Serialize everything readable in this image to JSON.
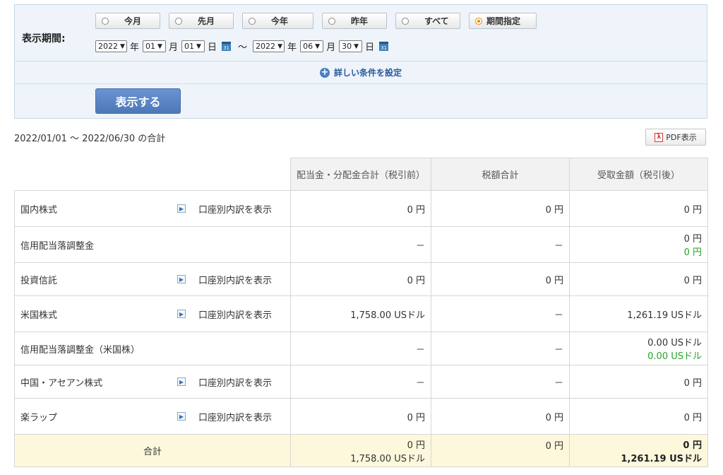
{
  "filter": {
    "period_label": "表示期間:",
    "radios": [
      {
        "label": "今月",
        "checked": false
      },
      {
        "label": "先月",
        "checked": false
      },
      {
        "label": "今年",
        "checked": false
      },
      {
        "label": "昨年",
        "checked": false
      },
      {
        "label": "すべて",
        "checked": false
      },
      {
        "label": "期間指定",
        "checked": true
      }
    ],
    "from": {
      "year": "2022",
      "month": "01",
      "day": "01"
    },
    "to": {
      "year": "2022",
      "month": "06",
      "day": "30"
    },
    "unit_year": "年",
    "unit_month": "月",
    "unit_day": "日",
    "tilde": "〜",
    "calendar_icon_text": "31",
    "detail_link": "詳しい条件を設定",
    "show_button": "表示する"
  },
  "summary": {
    "period_text": "2022/01/01 〜 2022/06/30 の合計",
    "pdf_button": "PDF表示"
  },
  "table": {
    "headers": [
      "配当金・分配金合計（税引前）",
      "税額合計",
      "受取金額（税引後）"
    ],
    "toggle_label": "口座別内訳を表示",
    "rows": [
      {
        "name": "国内株式",
        "toggle": true,
        "pretax": "0 円",
        "tax": "0 円",
        "received": "0 円",
        "received2": ""
      },
      {
        "name": "信用配当落調整金",
        "toggle": false,
        "pretax": "－",
        "tax": "－",
        "received": "0 円",
        "received2": "0 円"
      },
      {
        "name": "投資信託",
        "toggle": true,
        "pretax": "0 円",
        "tax": "0 円",
        "received": "0 円",
        "received2": ""
      },
      {
        "name": "米国株式",
        "toggle": true,
        "pretax": "1,758.00 USドル",
        "tax": "－",
        "received": "1,261.19 USドル",
        "received2": ""
      },
      {
        "name": "信用配当落調整金（米国株）",
        "toggle": false,
        "pretax": "－",
        "tax": "－",
        "received": "0.00 USドル",
        "received2": "0.00 USドル"
      },
      {
        "name": "中国・アセアン株式",
        "toggle": true,
        "pretax": "－",
        "tax": "－",
        "received": "0 円",
        "received2": ""
      },
      {
        "name": "楽ラップ",
        "toggle": true,
        "pretax": "0 円",
        "tax": "0 円",
        "received": "0 円",
        "received2": ""
      }
    ],
    "total": {
      "label": "合計",
      "pretax_1": "0 円",
      "pretax_2": "1,758.00 USドル",
      "tax": "0 円",
      "received_1": "0 円",
      "received_2": "1,261.19 USドル"
    }
  }
}
